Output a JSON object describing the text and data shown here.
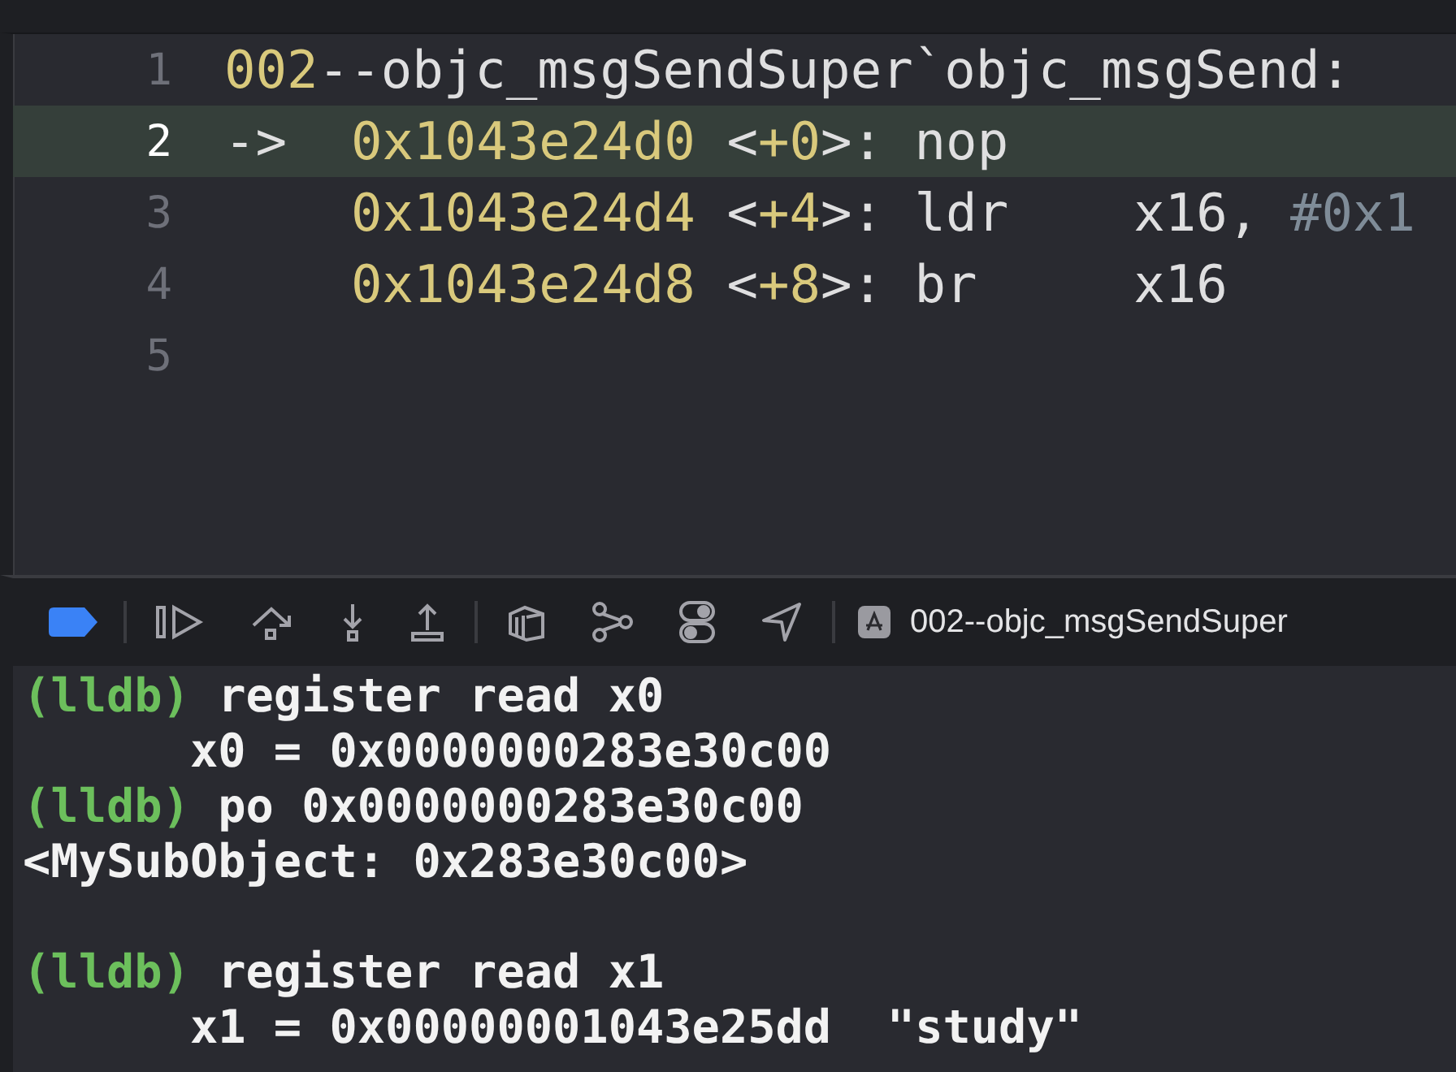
{
  "editor": {
    "lines": [
      {
        "number": "1",
        "current": false,
        "segments": [
          {
            "text": "002",
            "kind": "number"
          },
          {
            "text": "--objc_msgSendSuper`objc_msgSend:",
            "kind": "plain"
          }
        ]
      },
      {
        "number": "2",
        "current": true,
        "marker": "->",
        "segments": [
          {
            "text": "0x1043e24d0",
            "kind": "number"
          },
          {
            "text": " <",
            "kind": "plain"
          },
          {
            "text": "+0",
            "kind": "number"
          },
          {
            "text": ">: nop",
            "kind": "plain"
          }
        ]
      },
      {
        "number": "3",
        "current": false,
        "segments": [
          {
            "text": "0x1043e24d4",
            "kind": "number"
          },
          {
            "text": " <",
            "kind": "plain"
          },
          {
            "text": "+4",
            "kind": "number"
          },
          {
            "text": ">: ldr    x16, ",
            "kind": "plain"
          },
          {
            "text": "#0x1",
            "kind": "comment"
          }
        ]
      },
      {
        "number": "4",
        "current": false,
        "segments": [
          {
            "text": "0x1043e24d8",
            "kind": "number"
          },
          {
            "text": " <",
            "kind": "plain"
          },
          {
            "text": "+8",
            "kind": "number"
          },
          {
            "text": ">: br     x16",
            "kind": "plain"
          }
        ]
      },
      {
        "number": "5",
        "current": false
      }
    ]
  },
  "debug_bar": {
    "breakpoints_active": true,
    "target": "002--objc_msgSendSuper"
  },
  "console": {
    "lines": [
      {
        "kind": "command",
        "prompt": "(lldb)",
        "text": " register read x0"
      },
      {
        "kind": "output",
        "text": "      x0 = 0x0000000283e30c00"
      },
      {
        "kind": "command",
        "prompt": "(lldb)",
        "text": " po 0x0000000283e30c00"
      },
      {
        "kind": "output",
        "text": "<MySubObject: 0x283e30c00>"
      },
      {
        "kind": "blank"
      },
      {
        "kind": "command",
        "prompt": "(lldb)",
        "text": " register read x1"
      },
      {
        "kind": "output",
        "text": "      x1 = 0x00000001043e25dd  \"study\""
      }
    ]
  }
}
